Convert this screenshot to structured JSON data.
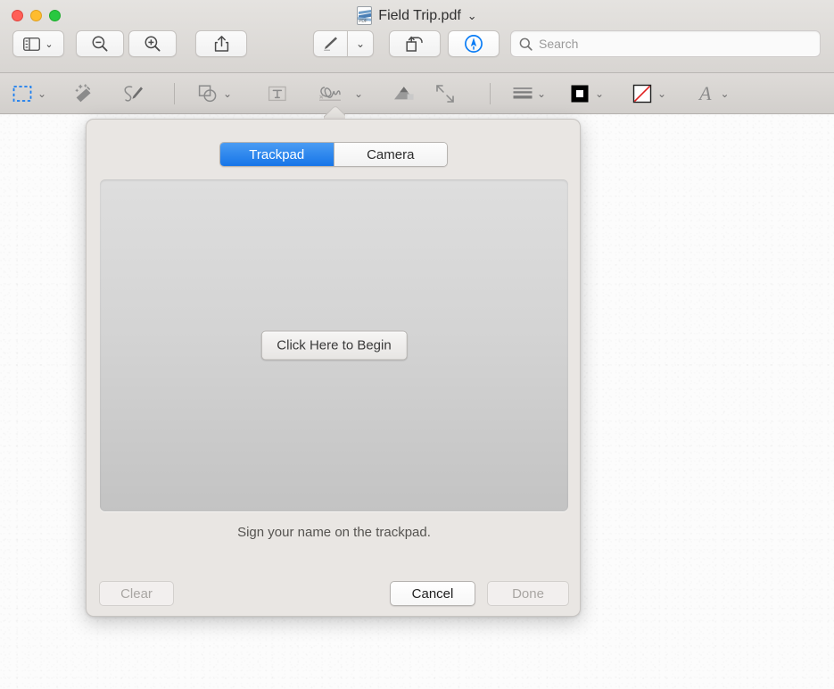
{
  "window": {
    "title": "Field Trip.pdf",
    "title_icon": "pdf-document-icon",
    "title_chevron": "⌄",
    "traffic_lights": [
      {
        "name": "close",
        "color": "#ff5f57"
      },
      {
        "name": "minimize",
        "color": "#febc2e"
      },
      {
        "name": "zoom",
        "color": "#28c840"
      }
    ]
  },
  "toolbar": {
    "sidebar_label": "sidebar-view",
    "sidebar_chevron": "⌄",
    "zoom_out_label": "zoom-out",
    "zoom_in_label": "zoom-in",
    "share_label": "share",
    "markup_label": "markup-pen",
    "markup_chevron": "⌄",
    "rotate_label": "rotate-left",
    "annotate_label": "annotate",
    "annotate_color": "#0a7cf5"
  },
  "search": {
    "placeholder": "Search",
    "value": "",
    "icon": "search-icon"
  },
  "markup_bar": {
    "selection_label": "rectangular-selection",
    "selection_chevron": "⌄",
    "selection_active": true,
    "selection_color": "#1a7ef0",
    "instant_alpha_label": "instant-alpha",
    "sketch_label": "sketch",
    "shapes_label": "shapes",
    "shapes_chevron": "⌄",
    "text_label": "text-box",
    "signature_label": "signature",
    "signature_chevron": "⌄",
    "note_label": "note",
    "crop_label": "crop",
    "border_style_label": "border-style",
    "border_style_chevron": "⌄",
    "border_color_label": "border-color",
    "border_color_chevron": "⌄",
    "fill_color_label": "fill-color",
    "fill_color_chevron": "⌄",
    "fill_color_none": "#e02020",
    "text_style_label": "A",
    "text_style_chevron": "⌄"
  },
  "popover": {
    "tabs": [
      {
        "label": "Trackpad",
        "active": true
      },
      {
        "label": "Camera",
        "active": false
      }
    ],
    "begin_button": "Click Here to Begin",
    "hint": "Sign your name on the trackpad.",
    "buttons": [
      {
        "label": "Clear",
        "enabled": false
      },
      {
        "label": "Cancel",
        "enabled": true
      },
      {
        "label": "Done",
        "enabled": false
      }
    ],
    "accent_color": "#1675e8"
  }
}
